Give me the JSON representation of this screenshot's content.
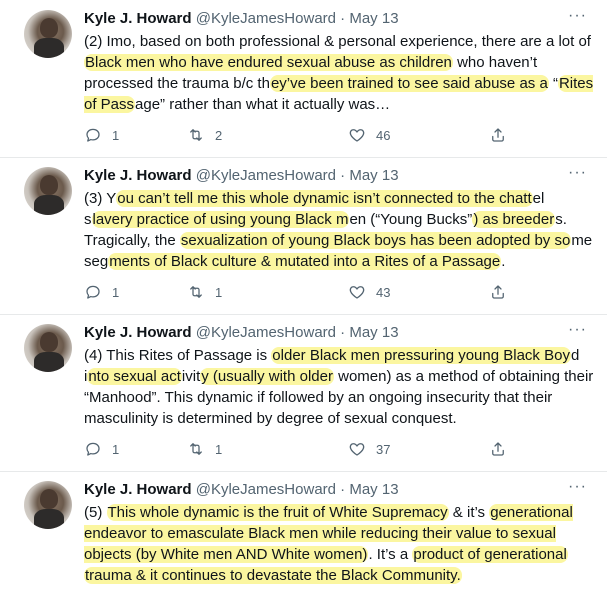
{
  "tweets": [
    {
      "name": "Kyle J. Howard",
      "handle": "@KyleJamesHoward",
      "dot": "·",
      "date": "May 13",
      "more": "···",
      "segments": [
        {
          "t": "(2) Imo, based on both professional & personal experience, there are a lot of "
        },
        {
          "t": "Black men who have endured sexual abuse as children",
          "h": true
        },
        {
          "t": " who haven’t processed the trauma b/c th"
        },
        {
          "t": "ey’ve been trained to see said abuse as a",
          "h": true
        },
        {
          "t": " “"
        },
        {
          "t": "Rites of Pass",
          "h": true
        },
        {
          "t": "age” rather than what it actually was…"
        }
      ],
      "replies": "1",
      "retweets": "2",
      "likes": "46"
    },
    {
      "name": "Kyle J. Howard",
      "handle": "@KyleJamesHoward",
      "dot": "·",
      "date": "May 13",
      "more": "···",
      "segments": [
        {
          "t": "(3) Y"
        },
        {
          "t": "ou can’t tell me this whole dynamic isn’t connected to the chatt",
          "h": true
        },
        {
          "t": "el s"
        },
        {
          "t": "lavery practice of using young Black m",
          "h": true
        },
        {
          "t": "en (“Young Bucks”"
        },
        {
          "t": ") as breeder",
          "h": true
        },
        {
          "t": "s. Tragically, the "
        },
        {
          "t": "sexualization of young Black boys has been adopted by so",
          "h": true
        },
        {
          "t": "me seg"
        },
        {
          "t": "ments of Black culture & mutated into a Rites of a Passage",
          "h": true
        },
        {
          "t": "."
        }
      ],
      "replies": "1",
      "retweets": "1",
      "likes": "43"
    },
    {
      "name": "Kyle J. Howard",
      "handle": "@KyleJamesHoward",
      "dot": "·",
      "date": "May 13",
      "more": "···",
      "segments": [
        {
          "t": "(4) This Rites of Passage is "
        },
        {
          "t": "older Black men pressuring young Black Boy",
          "h": true
        },
        {
          "t": "d i"
        },
        {
          "t": "nto sexual act",
          "h": true
        },
        {
          "t": "ivit"
        },
        {
          "t": "y (usually with older",
          "h": true
        },
        {
          "t": " women) as a method of obtaining their “Manhood”. This dynamic if followed by an ongoing insecurity that their masculinity is determined by degree of sexual conquest."
        }
      ],
      "replies": "1",
      "retweets": "1",
      "likes": "37"
    },
    {
      "name": "Kyle J. Howard",
      "handle": "@KyleJamesHoward",
      "dot": "·",
      "date": "May 13",
      "more": "···",
      "segments": [
        {
          "t": "(5) "
        },
        {
          "t": "This whole dynamic is the fruit of White Supremacy",
          "h": true
        },
        {
          "t": " & it’s "
        },
        {
          "t": "generational endeavor to emasculate Black men while reducing their value to sexual objects (by White men AND White women)",
          "h": true
        },
        {
          "t": ". It’s a "
        },
        {
          "t": "product of generational",
          "h": true
        },
        {
          "t": " "
        },
        {
          "t": "trauma & it continues to devastate the Black Community.",
          "h": true
        }
      ]
    }
  ]
}
